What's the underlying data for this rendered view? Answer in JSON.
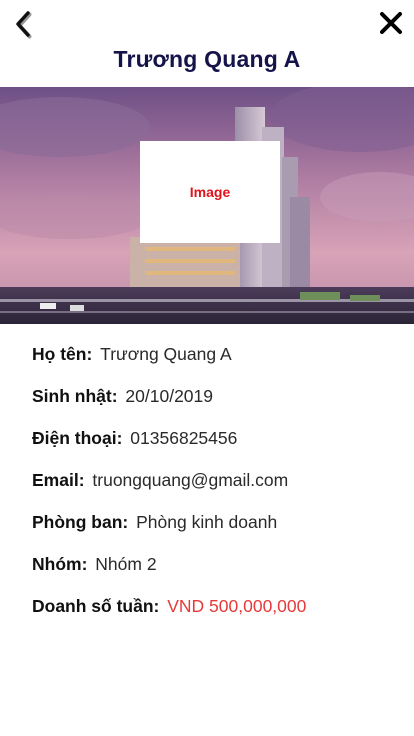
{
  "header": {
    "title": "Trương Quang A",
    "back_icon": "chevron-left-icon",
    "close_icon": "close-icon"
  },
  "banner": {
    "placeholder_label": "Image"
  },
  "profile": {
    "name_label": "Họ tên:",
    "name_value": "Trương Quang A",
    "birthday_label": "Sinh nhật:",
    "birthday_value": "20/10/2019",
    "phone_label": "Điện thoại:",
    "phone_value": "01356825456",
    "email_label": "Email:",
    "email_value": "truongquang@gmail.com",
    "department_label": "Phòng ban:",
    "department_value": "Phòng kinh doanh",
    "group_label": "Nhóm:",
    "group_value": "Nhóm 2",
    "sales_label": "Doanh số tuần:",
    "sales_value": "VND 500,000,000"
  },
  "colors": {
    "title": "#15134a",
    "accent_red": "#e63a3a",
    "placeholder_text": "#e0121b"
  }
}
